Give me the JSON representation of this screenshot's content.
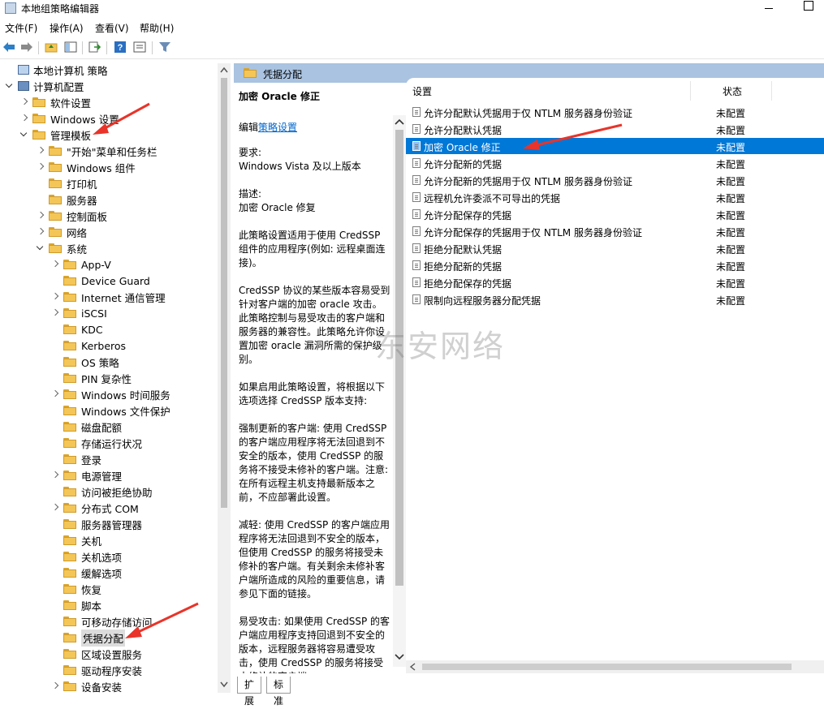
{
  "window": {
    "title": "本地组策略编辑器"
  },
  "menu": [
    "文件(F)",
    "操作(A)",
    "查看(V)",
    "帮助(H)"
  ],
  "tree": [
    {
      "label": "本地计算机 策略",
      "icon": "computer-icon",
      "level": 0,
      "exp": "none"
    },
    {
      "label": "计算机配置",
      "icon": "config-icon",
      "level": 0,
      "exp": "open"
    },
    {
      "label": "软件设置",
      "icon": "folder-icon",
      "level": 1,
      "exp": "closed"
    },
    {
      "label": "Windows 设置",
      "icon": "folder-icon",
      "level": 1,
      "exp": "closed"
    },
    {
      "label": "管理模板",
      "icon": "folder-icon",
      "level": 1,
      "exp": "open"
    },
    {
      "label": "\"开始\"菜单和任务栏",
      "icon": "folder-icon",
      "level": 2,
      "exp": "closed"
    },
    {
      "label": "Windows 组件",
      "icon": "folder-icon",
      "level": 2,
      "exp": "closed"
    },
    {
      "label": "打印机",
      "icon": "folder-icon",
      "level": 2,
      "exp": "none"
    },
    {
      "label": "服务器",
      "icon": "folder-icon",
      "level": 2,
      "exp": "none"
    },
    {
      "label": "控制面板",
      "icon": "folder-icon",
      "level": 2,
      "exp": "closed"
    },
    {
      "label": "网络",
      "icon": "folder-icon",
      "level": 2,
      "exp": "closed"
    },
    {
      "label": "系统",
      "icon": "folder-icon",
      "level": 2,
      "exp": "open"
    },
    {
      "label": "App-V",
      "icon": "folder-icon",
      "level": 3,
      "exp": "closed"
    },
    {
      "label": "Device Guard",
      "icon": "folder-icon",
      "level": 3,
      "exp": "none"
    },
    {
      "label": "Internet 通信管理",
      "icon": "folder-icon",
      "level": 3,
      "exp": "closed"
    },
    {
      "label": "iSCSI",
      "icon": "folder-icon",
      "level": 3,
      "exp": "closed"
    },
    {
      "label": "KDC",
      "icon": "folder-icon",
      "level": 3,
      "exp": "none"
    },
    {
      "label": "Kerberos",
      "icon": "folder-icon",
      "level": 3,
      "exp": "none"
    },
    {
      "label": "OS 策略",
      "icon": "folder-icon",
      "level": 3,
      "exp": "none"
    },
    {
      "label": "PIN 复杂性",
      "icon": "folder-icon",
      "level": 3,
      "exp": "none"
    },
    {
      "label": "Windows 时间服务",
      "icon": "folder-icon",
      "level": 3,
      "exp": "closed"
    },
    {
      "label": "Windows 文件保护",
      "icon": "folder-icon",
      "level": 3,
      "exp": "none"
    },
    {
      "label": "磁盘配额",
      "icon": "folder-icon",
      "level": 3,
      "exp": "none"
    },
    {
      "label": "存储运行状况",
      "icon": "folder-icon",
      "level": 3,
      "exp": "none"
    },
    {
      "label": "登录",
      "icon": "folder-icon",
      "level": 3,
      "exp": "none"
    },
    {
      "label": "电源管理",
      "icon": "folder-icon",
      "level": 3,
      "exp": "closed"
    },
    {
      "label": "访问被拒绝协助",
      "icon": "folder-icon",
      "level": 3,
      "exp": "none"
    },
    {
      "label": "分布式 COM",
      "icon": "folder-icon",
      "level": 3,
      "exp": "closed"
    },
    {
      "label": "服务器管理器",
      "icon": "folder-icon",
      "level": 3,
      "exp": "none"
    },
    {
      "label": "关机",
      "icon": "folder-icon",
      "level": 3,
      "exp": "none"
    },
    {
      "label": "关机选项",
      "icon": "folder-icon",
      "level": 3,
      "exp": "none"
    },
    {
      "label": "缓解选项",
      "icon": "folder-icon",
      "level": 3,
      "exp": "none"
    },
    {
      "label": "恢复",
      "icon": "folder-icon",
      "level": 3,
      "exp": "none"
    },
    {
      "label": "脚本",
      "icon": "folder-icon",
      "level": 3,
      "exp": "none"
    },
    {
      "label": "可移动存储访问",
      "icon": "folder-icon",
      "level": 3,
      "exp": "none"
    },
    {
      "label": "凭据分配",
      "icon": "folder-icon",
      "level": 3,
      "exp": "none",
      "selected": true
    },
    {
      "label": "区域设置服务",
      "icon": "folder-icon",
      "level": 3,
      "exp": "none"
    },
    {
      "label": "驱动程序安装",
      "icon": "folder-icon",
      "level": 3,
      "exp": "none"
    },
    {
      "label": "设备安装",
      "icon": "folder-icon",
      "level": 3,
      "exp": "closed"
    }
  ],
  "middle": {
    "header": "凭据分配",
    "title": "加密 Oracle 修正",
    "edit_prefix": "编辑",
    "edit_link": "策略设置",
    "paragraphs": [
      "要求:",
      "Windows Vista 及以上版本",
      "描述:",
      "加密 Oracle 修复",
      "此策略设置适用于使用 CredSSP 组件的应用程序(例如: 远程桌面连接)。",
      "CredSSP 协议的某些版本容易受到针对客户端的加密 oracle 攻击。此策略控制与易受攻击的客户端和服务器的兼容性。此策略允许你设置加密 oracle 漏洞所需的保护级别。",
      "如果启用此策略设置，将根据以下选项选择 CredSSP 版本支持:",
      "强制更新的客户端: 使用 CredSSP 的客户端应用程序将无法回退到不安全的版本，使用 CredSSP 的服务将不接受未修补的客户端。注意: 在所有远程主机支持最新版本之前，不应部署此设置。",
      "减轻: 使用 CredSSP 的客户端应用程序将无法回退到不安全的版本，但使用 CredSSP 的服务将接受未修补的客户端。有关剩余未修补客户端所造成的风险的重要信息，请参见下面的链接。",
      "易受攻击: 如果使用 CredSSP 的客户端应用程序支持回退到不安全的版本，远程服务器将容易遭受攻击，使用 CredSSP 的服务将接受未修补的客户端"
    ]
  },
  "list": {
    "col_setting": "设置",
    "col_state": "状态",
    "rows": [
      {
        "name": "允许分配默认凭据用于仅 NTLM 服务器身份验证",
        "state": "未配置"
      },
      {
        "name": "允许分配默认凭据",
        "state": "未配置"
      },
      {
        "name": "加密 Oracle 修正",
        "state": "未配置",
        "selected": true
      },
      {
        "name": "允许分配新的凭据",
        "state": "未配置"
      },
      {
        "name": "允许分配新的凭据用于仅 NTLM 服务器身份验证",
        "state": "未配置"
      },
      {
        "name": "远程机允许委派不可导出的凭据",
        "state": "未配置"
      },
      {
        "name": "允许分配保存的凭据",
        "state": "未配置"
      },
      {
        "name": "允许分配保存的凭据用于仅 NTLM 服务器身份验证",
        "state": "未配置"
      },
      {
        "name": "拒绝分配默认凭据",
        "state": "未配置"
      },
      {
        "name": "拒绝分配新的凭据",
        "state": "未配置"
      },
      {
        "name": "拒绝分配保存的凭据",
        "state": "未配置"
      },
      {
        "name": "限制向远程服务器分配凭据",
        "state": "未配置"
      }
    ]
  },
  "tabs": [
    "扩展",
    "标准"
  ],
  "watermark": "东安网络",
  "colors": {
    "selection": "#0078d7",
    "header": "#a9c3e0",
    "arrow": "#e8342a"
  }
}
